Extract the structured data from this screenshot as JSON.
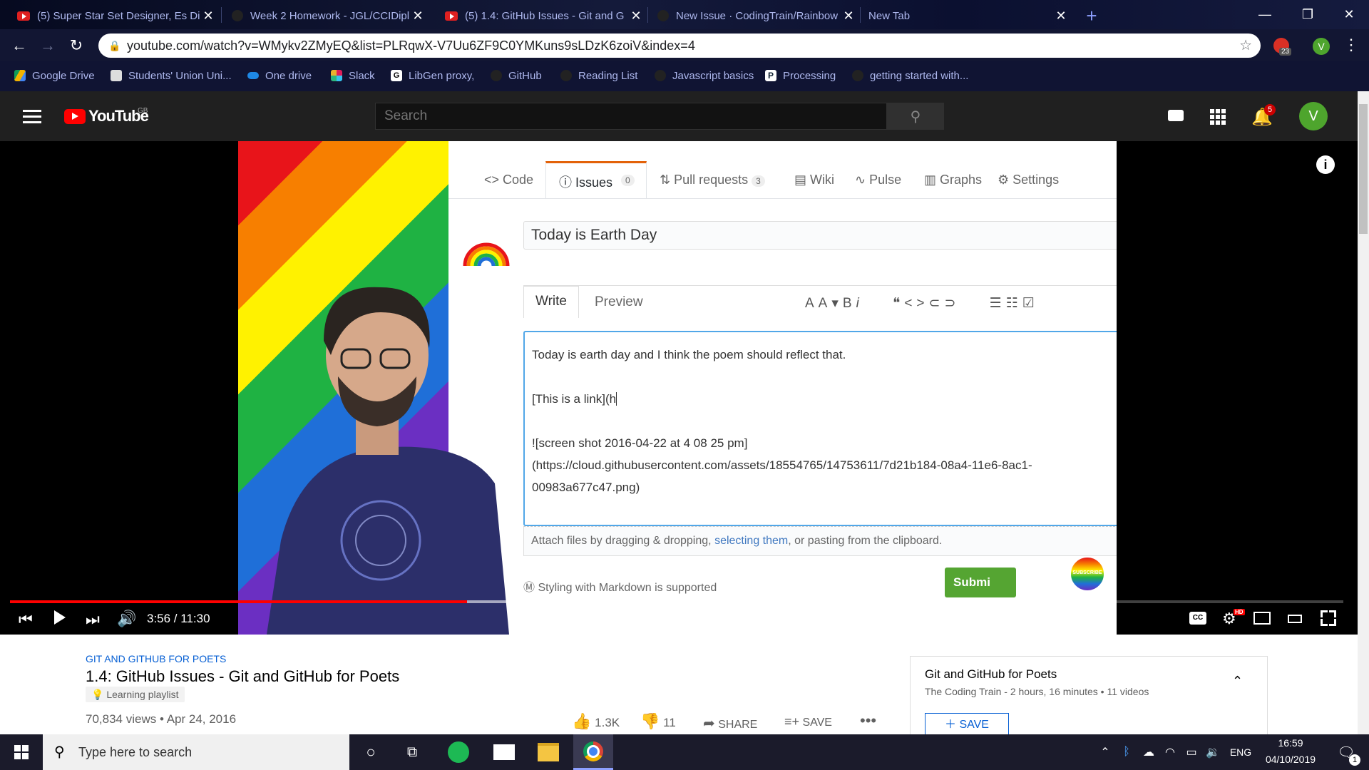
{
  "browser": {
    "tabs": [
      {
        "title": "(5) Super Star Set Designer, Es Di",
        "favicon": "youtube-icon"
      },
      {
        "title": "Week 2 Homework - JGL/CCIDipl",
        "favicon": "github-icon"
      },
      {
        "title": "(5) 1.4: GitHub Issues - Git and G",
        "favicon": "youtube-icon"
      },
      {
        "title": "New Issue · CodingTrain/Rainbow",
        "favicon": "github-icon"
      },
      {
        "title": "New Tab",
        "favicon": ""
      }
    ],
    "new_tab": "+",
    "url": "youtube.com/watch?v=WMykv2ZMyEQ&list=PLRqwX-V7Uu6ZF9C0YMKuns9sLDzK6zoiV&index=4",
    "extension_badge": "23",
    "profile_initial": "V",
    "bookmarks": [
      "Google Drive",
      "Students' Union Uni...",
      "One drive",
      "Slack",
      "LibGen proxy,",
      "GitHub",
      "Reading List",
      "Javascript basics",
      "Processing",
      "getting started with..."
    ]
  },
  "youtube": {
    "logo_text": "YouTube",
    "region": "GB",
    "search_placeholder": "Search",
    "notif_count": "5",
    "avatar_initial": "V"
  },
  "video_frame": {
    "tabs": [
      {
        "label": "Code"
      },
      {
        "label": "Issues",
        "count": "0"
      },
      {
        "label": "Pull requests",
        "count": "3"
      },
      {
        "label": "Wiki"
      },
      {
        "label": "Pulse"
      },
      {
        "label": "Graphs"
      },
      {
        "label": "Settings"
      }
    ],
    "issue_title": "Today is Earth Day",
    "write_tab": "Write",
    "preview_tab": "Preview",
    "body_lines": [
      "Today is earth day and I think the poem should reflect that.",
      "[This is a link](h",
      "![screen shot 2016-04-22 at 4 08 25 pm]",
      "(https://cloud.githubusercontent.com/assets/18554765/14753611/7d21b184-08a4-11e6-8ac1-",
      "00983a677c47.png)"
    ],
    "attach_text_before": "Attach files by dragging & dropping,",
    "attach_link": "selecting them",
    "attach_text_after": ", or pasting from the clipboard.",
    "markdown_note": "Styling with Markdown is supported",
    "submit_label": "Submi",
    "subscribe_text": "SUBSCRIBE"
  },
  "player": {
    "time": "3:56 / 11:30",
    "progress": 0.343,
    "buffered": 0.52
  },
  "video_info": {
    "playlist_tag": "GIT AND GITHUB FOR POETS",
    "title": "1.4: GitHub Issues - Git and GitHub for Poets",
    "badge": "Learning playlist",
    "views_date": "70,834 views • Apr 24, 2016",
    "likes": "1.3K",
    "dislikes": "11",
    "share": "SHARE",
    "save": "SAVE"
  },
  "playlist_panel": {
    "title": "Git and GitHub for Poets",
    "meta": "The Coding Train - 2 hours, 16 minutes • 11 videos",
    "save": "SAVE"
  },
  "taskbar": {
    "search_placeholder": "Type here to search",
    "lang": "ENG",
    "time": "16:59",
    "date": "04/10/2019",
    "notif_count": "1"
  }
}
